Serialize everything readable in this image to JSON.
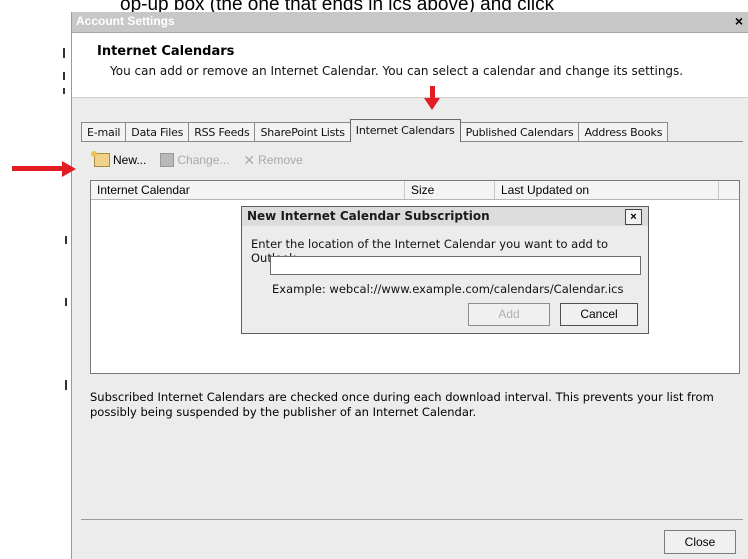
{
  "caption": {
    "text": "op-up box (the one that ends in ics above) and click"
  },
  "window": {
    "title": "Account Settings",
    "close_glyph": "×"
  },
  "header": {
    "title": "Internet Calendars",
    "description": "You can add or remove an Internet Calendar. You can select a calendar and change its settings."
  },
  "tabs": [
    {
      "label": "E-mail",
      "active": false
    },
    {
      "label": "Data Files",
      "active": false
    },
    {
      "label": "RSS Feeds",
      "active": false
    },
    {
      "label": "SharePoint Lists",
      "active": false
    },
    {
      "label": "Internet Calendars",
      "active": true
    },
    {
      "label": "Published Calendars",
      "active": false
    },
    {
      "label": "Address Books",
      "active": false
    }
  ],
  "toolbar": {
    "new_label": "New...",
    "change_label": "Change...",
    "remove_label": "Remove",
    "new_icon": "calendar-new-icon",
    "change_icon": "calendar-change-icon",
    "remove_icon": "remove-x-icon"
  },
  "list": {
    "columns": [
      "Internet Calendar",
      "Size",
      "Last Updated on"
    ]
  },
  "info_text": "Subscribed Internet Calendars are checked once during each download interval. This prevents your list from possibly being suspended by the publisher of an Internet Calendar.",
  "footer": {
    "close_label": "Close"
  },
  "dialog": {
    "title": "New Internet Calendar Subscription",
    "close_glyph": "×",
    "prompt": "Enter the location of the Internet Calendar you want to add to Outlook:",
    "input_value": "",
    "example": "Example: webcal://www.example.com/calendars/Calendar.ics",
    "add_label": "Add",
    "cancel_label": "Cancel"
  },
  "colors": {
    "arrow": "#e21d23",
    "window_bg": "#ececec"
  }
}
